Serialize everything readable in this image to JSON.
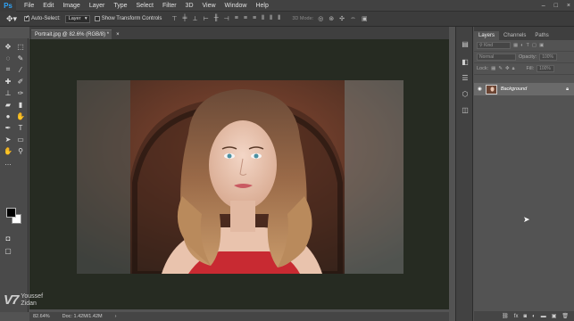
{
  "app": {
    "logo": "Ps"
  },
  "menu": [
    "File",
    "Edit",
    "Image",
    "Layer",
    "Type",
    "Select",
    "Filter",
    "3D",
    "View",
    "Window",
    "Help"
  ],
  "window_controls": [
    "–",
    "□",
    "×"
  ],
  "options": {
    "auto_select_label": "Auto-Select:",
    "auto_select_value": "Layer",
    "show_transform_label": "Show Transform Controls",
    "mode_3d_label": "3D Mode:"
  },
  "document": {
    "tab_title": "Portrait.jpg @ 82.6% (RGB/8) *",
    "close": "×"
  },
  "status": {
    "zoom": "82.64%",
    "doc_info": "Doc: 1.42M/1.42M",
    "arrow": "›"
  },
  "watermark": {
    "logo": "V7",
    "name_line1": "Youssef",
    "name_line2": "Zidan"
  },
  "panels": {
    "tabs": [
      "Layers",
      "Channels",
      "Paths"
    ],
    "filter_placeholder": "Kind",
    "blend_mode": "Normal",
    "opacity_label": "Opacity:",
    "opacity_value": "100%",
    "lock_label": "Lock:",
    "fill_label": "Fill:",
    "fill_value": "100%",
    "layer_name": "Background"
  },
  "colors": {
    "accent": "#2fa3f6",
    "canvas_bg": "#262b22",
    "ui_bg": "#535353"
  }
}
